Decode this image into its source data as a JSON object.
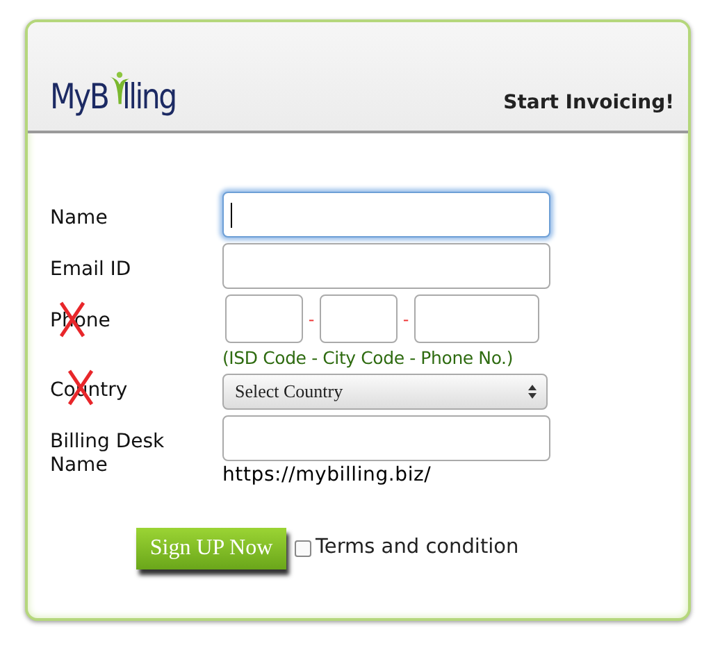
{
  "header": {
    "logo": {
      "before": "MyB",
      "after": "lling"
    },
    "tagline": "Start Invoicing!"
  },
  "fields": [
    {
      "kind": "text",
      "label": "Name",
      "focused": true,
      "crossed": false
    },
    {
      "kind": "text",
      "label": "Email ID",
      "focused": false,
      "crossed": false
    },
    {
      "kind": "phone",
      "label": "Phone",
      "focused": false,
      "crossed": true,
      "separators": [
        "-",
        "-"
      ],
      "hint": "(ISD Code - City Code - Phone No.)"
    },
    {
      "kind": "select",
      "label": "Country",
      "focused": false,
      "crossed": true,
      "value": "Select Country"
    },
    {
      "kind": "text",
      "label": "Billing Desk Name",
      "focused": false,
      "crossed": false,
      "note": "https://mybilling.biz/"
    }
  ],
  "submit": "Sign UP Now",
  "terms": {
    "label": "Terms and condition",
    "checked": false
  }
}
